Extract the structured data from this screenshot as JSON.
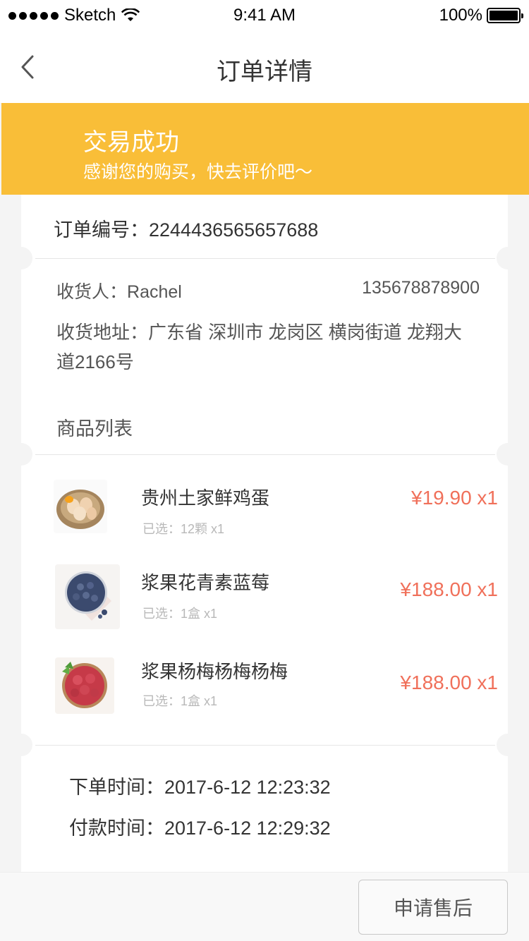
{
  "status_bar": {
    "carrier": "Sketch",
    "time": "9:41 AM",
    "battery": "100%"
  },
  "nav": {
    "title": "订单详情"
  },
  "banner": {
    "title": "交易成功",
    "subtitle": "感谢您的购买，快去评价吧～",
    "color": "#f9be38"
  },
  "order": {
    "number_label": "订单编号：",
    "number": "2244436565657688",
    "receiver_label": "收货人：",
    "receiver": "Rachel",
    "phone": "135678878900",
    "address_label": "收货地址：",
    "address": "广东省 深圳市 龙岗区 横岗街道 龙翔大道2166号",
    "list_title": "商品列表"
  },
  "products": [
    {
      "name": "贵州土家鲜鸡蛋",
      "spec": "已选：12颗   x1",
      "price": "¥19.90 x1",
      "image": "eggs-basket"
    },
    {
      "name": "浆果花青素蓝莓",
      "spec": "已选：1盒   x1",
      "price": "¥188.00 x1",
      "image": "blueberries-bowl"
    },
    {
      "name": "浆果杨梅杨梅杨梅",
      "spec": "已选：1盒   x1",
      "price": "¥188.00 x1",
      "image": "raspberries-bowl"
    }
  ],
  "times": {
    "order_time_label": "下单时间：",
    "order_time": "2017-6-12    12:23:32",
    "pay_time_label": "付款时间：",
    "pay_time": "2017-6-12    12:29:32"
  },
  "footer": {
    "after_sale_label": "申请售后"
  },
  "colors": {
    "price": "#f0705a",
    "background": "#f4f4f4"
  }
}
